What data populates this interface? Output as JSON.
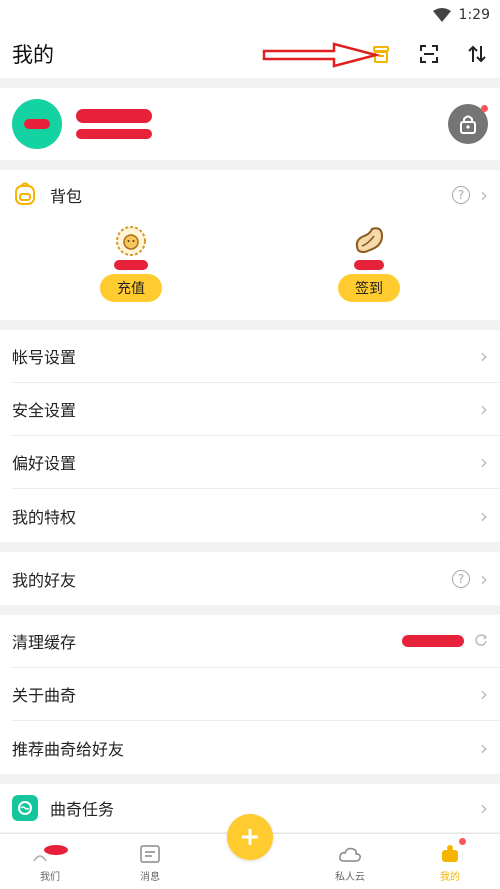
{
  "status": {
    "time": "1:29"
  },
  "header": {
    "title": "我的"
  },
  "backpack": {
    "label": "背包",
    "items": [
      {
        "button": "充值",
        "icon": "lion-coin-icon"
      },
      {
        "button": "签到",
        "icon": "bean-icon"
      }
    ]
  },
  "settings": [
    {
      "label": "帐号设置"
    },
    {
      "label": "安全设置"
    },
    {
      "label": "偏好设置"
    },
    {
      "label": "我的特权"
    }
  ],
  "friends": {
    "label": "我的好友"
  },
  "misc": [
    {
      "label": "清理缓存"
    },
    {
      "label": "关于曲奇"
    },
    {
      "label": "推荐曲奇给好友"
    }
  ],
  "task": {
    "label": "曲奇任务"
  },
  "nav": {
    "items": [
      {
        "label": "我们"
      },
      {
        "label": "消息"
      },
      {
        "label": "私人云"
      },
      {
        "label": "我的"
      }
    ]
  },
  "colors": {
    "accent": "#ffcb2f",
    "teal": "#16c59b",
    "redaction": "#e8213a"
  }
}
